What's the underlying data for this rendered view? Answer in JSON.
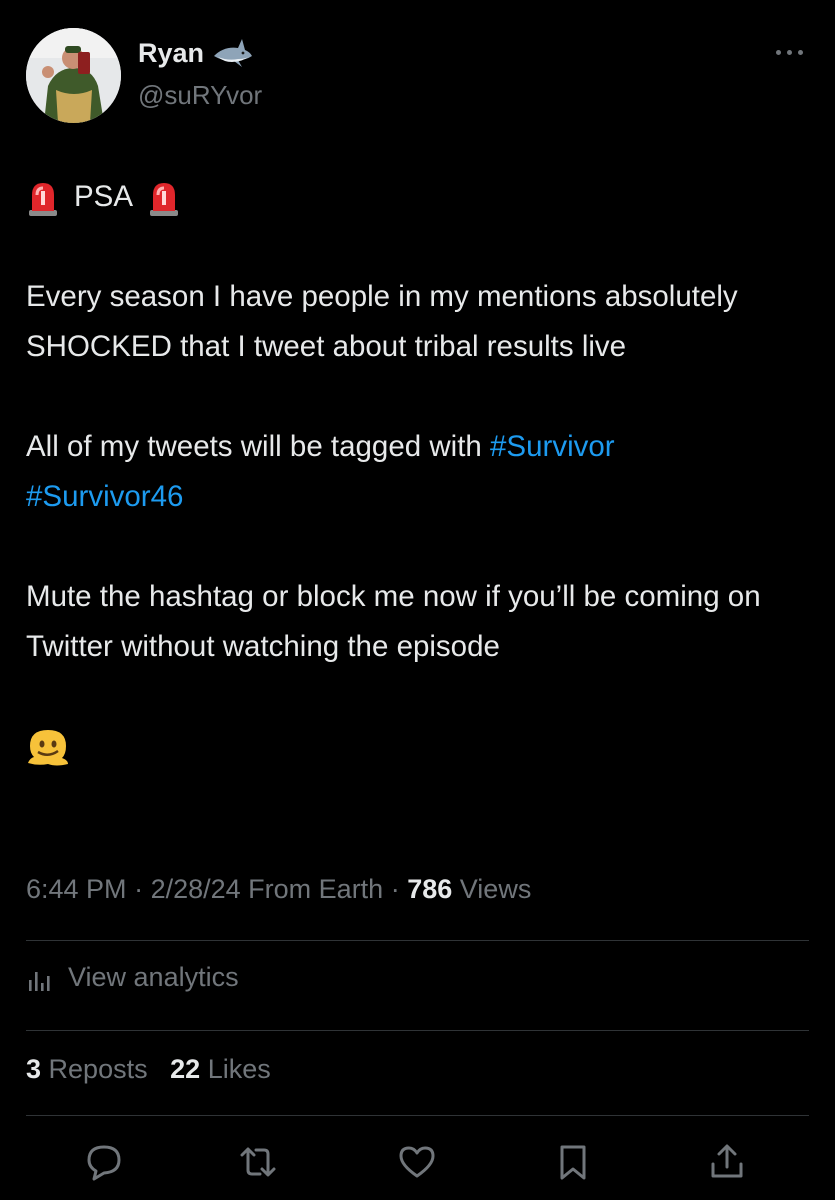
{
  "author": {
    "name": "Ryan",
    "handle": "@suRYvor",
    "badge_icon": "shark-emoji",
    "avatar_icon": "avatar-photo"
  },
  "tweet": {
    "psa_label": "PSA",
    "emoji_left": "police-light-emoji",
    "emoji_right": "police-light-emoji",
    "paragraph1": "Every season I have people in my mentions absolutely SHOCKED that I tweet about tribal results live",
    "paragraph2_text": "All of my tweets will be tagged with ",
    "hashtag1": "#Survivor",
    "hashtag2": "#Survivor46",
    "paragraph3": "Mute the hashtag or block me now if you’ll be coming on Twitter without watching the episode",
    "final_emoji": "melting-face-emoji"
  },
  "meta": {
    "time": "6:44 PM",
    "separator": " · ",
    "date": "2/28/24",
    "source": "From Earth",
    "views_count": "786",
    "views_label": "Views"
  },
  "analytics": {
    "label": "View analytics",
    "icon": "analytics-icon"
  },
  "counts": {
    "reposts_count": "3",
    "reposts_label": "Reposts",
    "likes_count": "22",
    "likes_label": "Likes"
  },
  "actions": [
    "reply-icon",
    "repost-icon",
    "like-icon",
    "bookmark-icon",
    "share-icon"
  ],
  "colors": {
    "background": "#000000",
    "text": "#e7e9ea",
    "secondary": "#71767b",
    "link": "#1d9bf0",
    "divider": "#2f3336"
  }
}
